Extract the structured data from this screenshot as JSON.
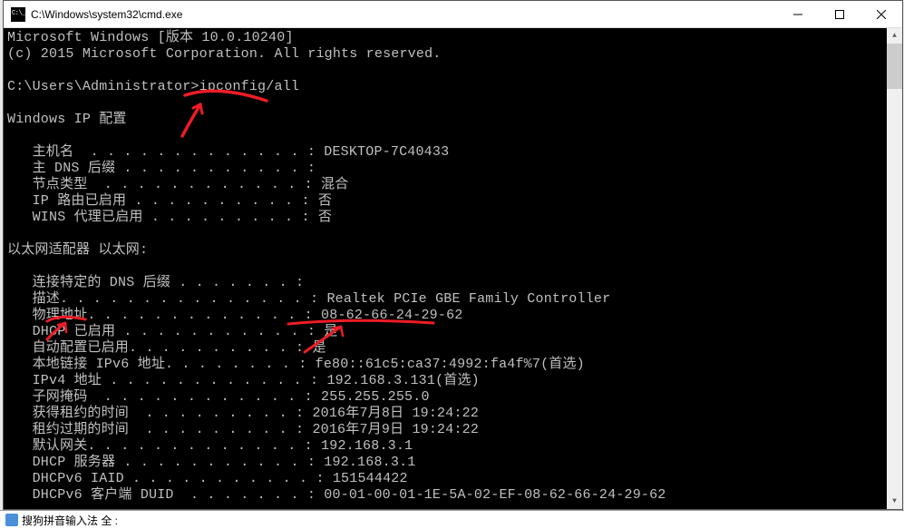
{
  "window": {
    "title": "C:\\Windows\\system32\\cmd.exe"
  },
  "terminal": {
    "header1": "Microsoft Windows [版本 10.0.10240]",
    "header2": "(c) 2015 Microsoft Corporation. All rights reserved.",
    "blank": "",
    "prompt": "C:\\Users\\Administrator>",
    "command": "ipconfig/all",
    "section1": "Windows IP 配置",
    "host_label": "   主机名  . . . . . . . . . . . . . : ",
    "host_val": "DESKTOP-7C40433",
    "dns_suffix": "   主 DNS 后缀 . . . . . . . . . . . :",
    "nodetype_label": "   节点类型  . . . . . . . . . . . . : ",
    "nodetype_val": "混合",
    "iproute_label": "   IP 路由已启用 . . . . . . . . . . : ",
    "iproute_val": "否",
    "wins_label": "   WINS 代理已启用 . . . . . . . . . : ",
    "wins_val": "否",
    "section2": "以太网适配器 以太网:",
    "conn_dns": "   连接特定的 DNS 后缀 . . . . . . . :",
    "desc_label": "   描述. . . . . . . . . . . . . . . : ",
    "desc_val": "Realtek PCIe GBE Family Controller",
    "mac_label": "   物理地址. . . . . . . . . . . . . : ",
    "mac_val": "08-62-66-24-29-62",
    "dhcp_label": "   DHCP 已启用 . . . . . . . . . . . : ",
    "dhcp_val": "是",
    "auto_label": "   自动配置已启用. . . . . . . . . . : ",
    "auto_val": "是",
    "ipv6_label": "   本地链接 IPv6 地址. . . . . . . . : ",
    "ipv6_val": "fe80::61c5:ca37:4992:fa4f%7(首选)",
    "ipv4_label": "   IPv4 地址 . . . . . . . . . . . . : ",
    "ipv4_val": "192.168.3.131(首选)",
    "mask_label": "   子网掩码  . . . . . . . . . . . . : ",
    "mask_val": "255.255.255.0",
    "lease1_label": "   获得租约的时间  . . . . . . . . . : ",
    "lease1_val": "2016年7月8日 19:24:22",
    "lease2_label": "   租约过期的时间  . . . . . . . . . : ",
    "lease2_val": "2016年7月9日 19:24:22",
    "gw_label": "   默认网关. . . . . . . . . . . . . : ",
    "gw_val": "192.168.3.1",
    "dhcps_label": "   DHCP 服务器 . . . . . . . . . . . : ",
    "dhcps_val": "192.168.3.1",
    "iaid_label": "   DHCPv6 IAID . . . . . . . . . . . : ",
    "iaid_val": "151544422",
    "duid_label": "   DHCPv6 客户端 DUID  . . . . . . . : ",
    "duid_val": "00-01-00-01-1E-5A-02-EF-08-62-66-24-29-62"
  },
  "ime": {
    "text": "搜狗拼音输入法 全 :"
  },
  "annotations": {
    "color": "#ee1c25"
  }
}
